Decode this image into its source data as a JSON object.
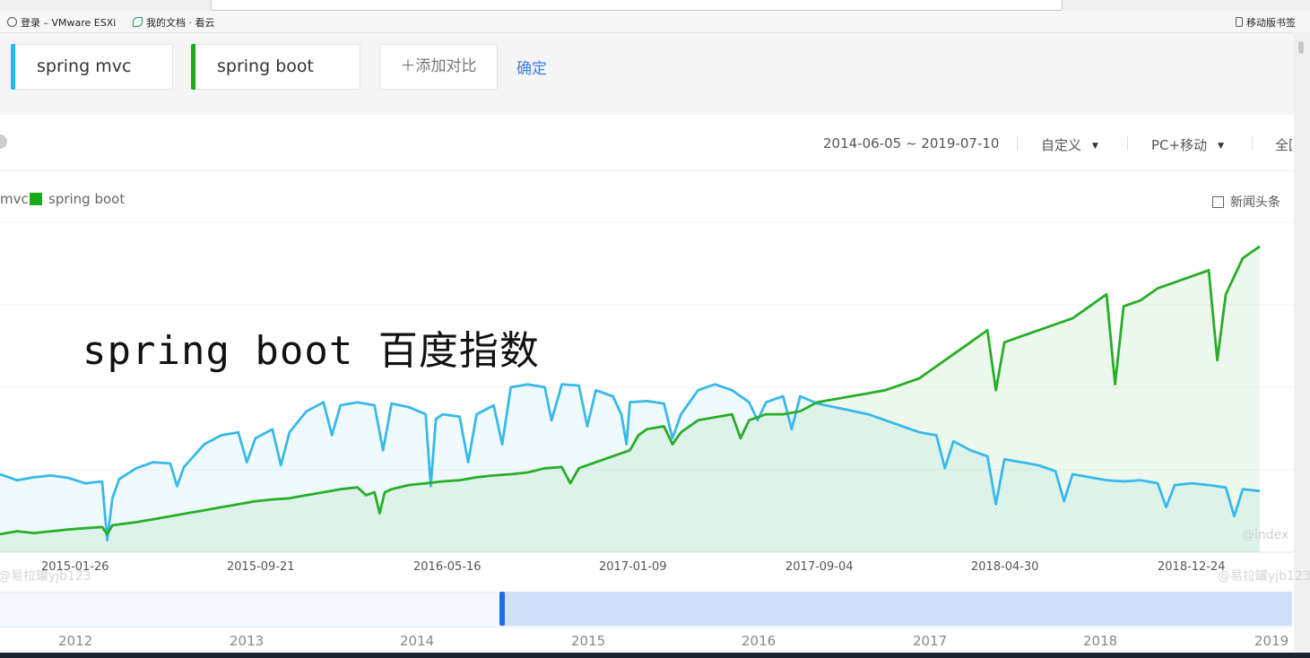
{
  "browser": {
    "bookmarks": [
      {
        "icon": "globe-icon",
        "label": "登录 – VMware ESXi"
      },
      {
        "icon": "leaf-icon",
        "label": "我的文档 · 看云"
      }
    ],
    "mobile_bookmarks": {
      "icon": "phone-icon",
      "label": "移动版书签"
    }
  },
  "compare": {
    "keywords": [
      {
        "label": "spring mvc",
        "color": "#29b6f6"
      },
      {
        "label": "spring boot",
        "color": "#1aab1a"
      }
    ],
    "add_label": "＋添加对比",
    "confirm_label": "确定"
  },
  "toolbar": {
    "date_range": "2014-06-05 ~ 2019-07-10",
    "period": "自定义",
    "device": "PC+移动",
    "region": "全国"
  },
  "legend": {
    "mvc_fragment": "mvc",
    "boot_label": "spring boot",
    "news_label": "新闻头条"
  },
  "overlay_title": "spring boot 百度指数",
  "watermarks": {
    "left": "@易拉罐yjb123",
    "right": "@易拉罐yjb123",
    "index": "@index"
  },
  "chart_data": {
    "type": "line",
    "x_ticks": [
      "2015-01-26",
      "2015-09-21",
      "2016-05-16",
      "2017-01-09",
      "2017-09-04",
      "2018-04-30",
      "2018-12-24"
    ],
    "series": [
      {
        "name": "spring mvc",
        "color": "#38b9ea",
        "points": [
          [
            0,
            280
          ],
          [
            1,
            270
          ],
          [
            2,
            275
          ],
          [
            3,
            278
          ],
          [
            4,
            274
          ],
          [
            5,
            265
          ],
          [
            6,
            268
          ],
          [
            6.3,
            170
          ],
          [
            6.6,
            240
          ],
          [
            7,
            272
          ],
          [
            8,
            290
          ],
          [
            9,
            300
          ],
          [
            10,
            298
          ],
          [
            10.4,
            260
          ],
          [
            10.8,
            292
          ],
          [
            12,
            330
          ],
          [
            13,
            345
          ],
          [
            14,
            350
          ],
          [
            14.5,
            300
          ],
          [
            15,
            340
          ],
          [
            16,
            355
          ],
          [
            16.5,
            295
          ],
          [
            17,
            350
          ],
          [
            18,
            385
          ],
          [
            19,
            400
          ],
          [
            19.5,
            345
          ],
          [
            20,
            395
          ],
          [
            21,
            400
          ],
          [
            22,
            395
          ],
          [
            22.5,
            320
          ],
          [
            23,
            398
          ],
          [
            24,
            392
          ],
          [
            25,
            380
          ],
          [
            25.3,
            260
          ],
          [
            25.6,
            372
          ],
          [
            26,
            380
          ],
          [
            27,
            376
          ],
          [
            27.5,
            300
          ],
          [
            28,
            380
          ],
          [
            29,
            395
          ],
          [
            29.5,
            330
          ],
          [
            30,
            425
          ],
          [
            31,
            430
          ],
          [
            32,
            425
          ],
          [
            32.4,
            370
          ],
          [
            33,
            430
          ],
          [
            34,
            428
          ],
          [
            34.5,
            360
          ],
          [
            35,
            420
          ],
          [
            36,
            410
          ],
          [
            36.5,
            380
          ],
          [
            36.8,
            330
          ],
          [
            37,
            400
          ],
          [
            38,
            402
          ],
          [
            39,
            398
          ],
          [
            39.5,
            340
          ],
          [
            40,
            380
          ],
          [
            41,
            420
          ],
          [
            42,
            430
          ],
          [
            43,
            420
          ],
          [
            44,
            400
          ],
          [
            44.5,
            370
          ],
          [
            45,
            400
          ],
          [
            46,
            410
          ],
          [
            46.5,
            355
          ],
          [
            47,
            410
          ],
          [
            48,
            398
          ],
          [
            49,
            392
          ],
          [
            50,
            386
          ],
          [
            51,
            380
          ],
          [
            52,
            370
          ],
          [
            53,
            360
          ],
          [
            54,
            350
          ],
          [
            55,
            345
          ],
          [
            55.5,
            290
          ],
          [
            56,
            335
          ],
          [
            57,
            320
          ],
          [
            58,
            310
          ],
          [
            58.5,
            230
          ],
          [
            59,
            305
          ],
          [
            60,
            300
          ],
          [
            61,
            295
          ],
          [
            62,
            285
          ],
          [
            62.5,
            235
          ],
          [
            63,
            280
          ],
          [
            64,
            275
          ],
          [
            65,
            270
          ],
          [
            66,
            268
          ],
          [
            67,
            270
          ],
          [
            68,
            265
          ],
          [
            68.5,
            225
          ],
          [
            69,
            262
          ],
          [
            70,
            265
          ],
          [
            71,
            262
          ],
          [
            72,
            258
          ],
          [
            72.5,
            210
          ],
          [
            73,
            255
          ],
          [
            74,
            252
          ]
        ]
      },
      {
        "name": "spring boot",
        "color": "#28ad28",
        "points": [
          [
            0,
            180
          ],
          [
            1,
            185
          ],
          [
            2,
            182
          ],
          [
            3,
            185
          ],
          [
            4,
            188
          ],
          [
            5,
            190
          ],
          [
            6,
            192
          ],
          [
            6.3,
            180
          ],
          [
            6.6,
            195
          ],
          [
            8,
            200
          ],
          [
            9,
            205
          ],
          [
            10,
            210
          ],
          [
            11,
            215
          ],
          [
            12,
            220
          ],
          [
            13,
            225
          ],
          [
            14,
            230
          ],
          [
            15,
            235
          ],
          [
            16,
            238
          ],
          [
            17,
            240
          ],
          [
            18,
            245
          ],
          [
            19,
            250
          ],
          [
            20,
            255
          ],
          [
            21,
            258
          ],
          [
            21.5,
            245
          ],
          [
            22,
            250
          ],
          [
            22.3,
            215
          ],
          [
            22.6,
            250
          ],
          [
            23,
            255
          ],
          [
            24,
            262
          ],
          [
            25,
            265
          ],
          [
            26,
            268
          ],
          [
            27,
            270
          ],
          [
            28,
            275
          ],
          [
            29,
            278
          ],
          [
            30,
            280
          ],
          [
            31,
            283
          ],
          [
            32,
            290
          ],
          [
            33,
            292
          ],
          [
            33.5,
            265
          ],
          [
            34,
            290
          ],
          [
            35,
            300
          ],
          [
            36,
            310
          ],
          [
            37,
            320
          ],
          [
            37.5,
            345
          ],
          [
            38,
            355
          ],
          [
            39,
            360
          ],
          [
            39.5,
            330
          ],
          [
            40,
            350
          ],
          [
            41,
            370
          ],
          [
            42,
            375
          ],
          [
            43,
            380
          ],
          [
            43.5,
            340
          ],
          [
            44,
            370
          ],
          [
            45,
            380
          ],
          [
            46,
            380
          ],
          [
            47,
            385
          ],
          [
            48,
            400
          ],
          [
            49,
            405
          ],
          [
            50,
            410
          ],
          [
            51,
            415
          ],
          [
            52,
            420
          ],
          [
            53,
            430
          ],
          [
            54,
            440
          ],
          [
            55,
            460
          ],
          [
            56,
            480
          ],
          [
            57,
            500
          ],
          [
            58,
            520
          ],
          [
            58.5,
            420
          ],
          [
            59,
            500
          ],
          [
            60,
            510
          ],
          [
            61,
            520
          ],
          [
            62,
            530
          ],
          [
            63,
            540
          ],
          [
            64,
            560
          ],
          [
            65,
            580
          ],
          [
            65.5,
            430
          ],
          [
            66,
            560
          ],
          [
            67,
            570
          ],
          [
            68,
            590
          ],
          [
            69,
            600
          ],
          [
            70,
            610
          ],
          [
            71,
            620
          ],
          [
            71.5,
            470
          ],
          [
            72,
            580
          ],
          [
            73,
            640
          ],
          [
            74,
            660
          ]
        ]
      }
    ],
    "ylim": [
      150,
      700
    ],
    "xlim": [
      0,
      76
    ]
  }
}
